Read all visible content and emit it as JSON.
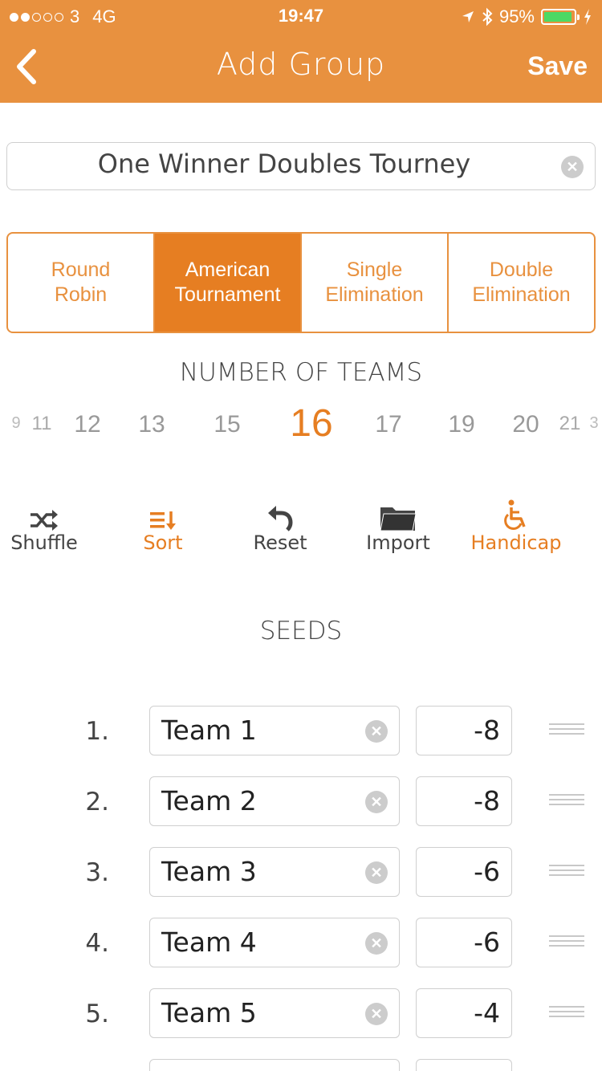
{
  "status_bar": {
    "carrier": "3",
    "network": "4G",
    "time": "19:47",
    "battery": "95%",
    "battery_level": 0.95
  },
  "nav": {
    "title": "Add Group",
    "save_label": "Save",
    "back_icon": "chevron-left-icon"
  },
  "group_name": {
    "value": "One Winner Doubles Tourney"
  },
  "format_segments": [
    {
      "label_line1": "Round",
      "label_line2": "Robin",
      "active": false
    },
    {
      "label_line1": "American",
      "label_line2": "Tournament",
      "active": true
    },
    {
      "label_line1": "Single",
      "label_line2": "Elimination",
      "active": false
    },
    {
      "label_line1": "Double",
      "label_line2": "Elimination",
      "active": false
    }
  ],
  "teams": {
    "label": "NUMBER OF TEAMS",
    "picker_values": [
      "9",
      "11",
      "12",
      "13",
      "15",
      "16",
      "17",
      "19",
      "20",
      "21",
      "3"
    ],
    "selected": "16"
  },
  "toolbar": [
    {
      "label": "Shuffle",
      "icon": "shuffle-icon",
      "color": "#444444"
    },
    {
      "label": "Sort",
      "icon": "sort-icon",
      "color": "#E67E22"
    },
    {
      "label": "Reset",
      "icon": "undo-icon",
      "color": "#444444"
    },
    {
      "label": "Import",
      "icon": "folder-icon",
      "color": "#444444"
    },
    {
      "label": "Handicap",
      "icon": "wheelchair-icon",
      "color": "#E67E22"
    }
  ],
  "seeds": {
    "label": "SEEDS",
    "rows": [
      {
        "num": "1.",
        "team": "Team 1",
        "handicap": "-8"
      },
      {
        "num": "2.",
        "team": "Team 2",
        "handicap": "-8"
      },
      {
        "num": "3.",
        "team": "Team 3",
        "handicap": "-6"
      },
      {
        "num": "4.",
        "team": "Team 4",
        "handicap": "-6"
      },
      {
        "num": "5.",
        "team": "Team 5",
        "handicap": "-4"
      }
    ]
  },
  "colors": {
    "accent": "#E8913F",
    "active_segment": "#E67E22",
    "battery_fill": "#4CD964"
  }
}
